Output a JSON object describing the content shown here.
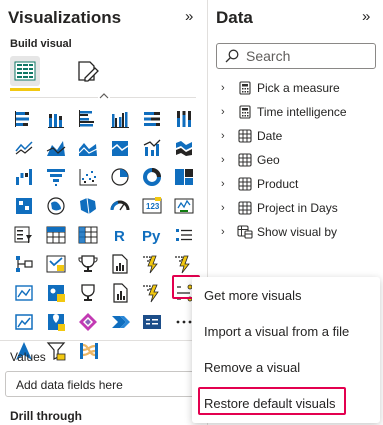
{
  "visualizations": {
    "title": "Visualizations",
    "build_label": "Build visual",
    "values_label": "Values",
    "values_placeholder": "Add data fields here",
    "drill_label": "Drill through",
    "grid_icons": [
      [
        "stacked-bar-chart-icon",
        "stacked-column-chart-icon",
        "clustered-bar-chart-icon",
        "clustered-column-chart-icon",
        "100-stacked-bar-chart-icon",
        "100-stacked-column-chart-icon"
      ],
      [
        "line-chart-icon",
        "area-chart-icon",
        "stacked-area-chart-icon",
        "line-and-column-chart-icon",
        "line-and-clustered-column-chart-icon",
        "ribbon-chart-icon"
      ],
      [
        "waterfall-chart-icon",
        "funnel-chart-icon",
        "scatter-chart-icon",
        "pie-chart-icon",
        "donut-chart-icon",
        "treemap-icon"
      ],
      [
        "map-icon",
        "filled-map-icon",
        "shape-map-icon",
        "gauge-icon",
        "card-icon",
        "multi-row-card-icon"
      ],
      [
        "kpi-icon",
        "slicer-icon",
        "table-icon",
        "matrix-icon",
        "r-script-visual-icon",
        "python-visual-icon"
      ],
      [
        "key-influencers-icon",
        "decomposition-tree-icon",
        "qa-icon",
        "smart-narrative-icon",
        "paginated-report-icon",
        "power-apps-icon"
      ],
      [
        "power-automate-icon",
        "azure-map-icon",
        "arcgis-map-icon",
        "chevron-visual-icon",
        "metrics-icon",
        "more-visuals-icon"
      ],
      [
        "navigation-icon",
        "filter-visual-icon",
        "sankey-icon"
      ]
    ]
  },
  "data_pane": {
    "title": "Data",
    "search_placeholder": "Search",
    "items": [
      {
        "label": "Pick a measure",
        "icon": "calculator-icon"
      },
      {
        "label": "Time intelligence",
        "icon": "calculator-icon"
      },
      {
        "label": "Date",
        "icon": "table-icon"
      },
      {
        "label": "Geo",
        "icon": "table-icon"
      },
      {
        "label": "Product",
        "icon": "table-icon"
      },
      {
        "label": "Project in Days",
        "icon": "table-icon"
      },
      {
        "label": "Show visual by",
        "icon": "table-multi-icon"
      }
    ]
  },
  "more_menu": {
    "items": [
      {
        "label": "Get more visuals"
      },
      {
        "label": "Import a visual from a file"
      },
      {
        "label": "Remove a visual"
      },
      {
        "label": "Restore default visuals"
      }
    ]
  },
  "colors": {
    "accent_yellow": "#f2c811",
    "highlight_red": "#e3004f",
    "icon_blue": "#106ebe",
    "icon_teal": "#0f7b84"
  }
}
